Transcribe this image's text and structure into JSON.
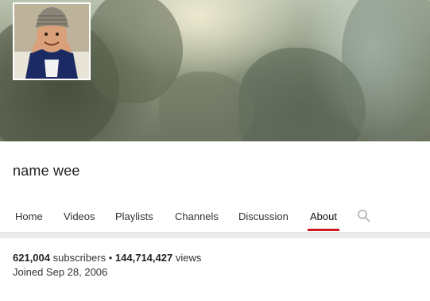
{
  "channel": {
    "name": "name wee"
  },
  "tabs": [
    {
      "label": "Home",
      "active": false
    },
    {
      "label": "Videos",
      "active": false
    },
    {
      "label": "Playlists",
      "active": false
    },
    {
      "label": "Channels",
      "active": false
    },
    {
      "label": "Discussion",
      "active": false
    },
    {
      "label": "About",
      "active": true
    }
  ],
  "search": {
    "icon": "search-icon"
  },
  "about": {
    "subscriber_count": "621,004",
    "subscribers_label": "subscribers",
    "separator": "•",
    "view_count": "144,714,427",
    "views_label": "views",
    "joined": "Joined Sep 28, 2006"
  },
  "colors": {
    "active_tab_underline": "#cc181e",
    "page_background": "#ebebeb"
  }
}
